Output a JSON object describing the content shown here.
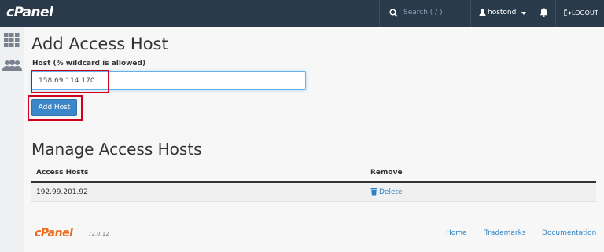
{
  "header": {
    "logo": "cPanel",
    "search_placeholder": "Search ( / )",
    "username": "hostond",
    "logout_label": "LOGOUT"
  },
  "sidebar": {
    "items": [
      {
        "icon": "grid-icon"
      },
      {
        "icon": "users-icon"
      }
    ]
  },
  "form": {
    "title": "Add Access Host",
    "field_label": "Host (% wildcard is allowed)",
    "host_value": "158.69.114.170",
    "submit_label": "Add Host"
  },
  "manage": {
    "title": "Manage Access Hosts",
    "columns": [
      "Access Hosts",
      "Remove"
    ],
    "rows": [
      {
        "host": "192.99.201.92",
        "action": "Delete"
      }
    ]
  },
  "footer": {
    "logo": "cPanel",
    "version": "72.0.12",
    "links": [
      "Home",
      "Trademarks",
      "Documentation"
    ]
  },
  "colors": {
    "navbar": "#293a4a",
    "accent": "#3b87c9",
    "highlight": "#d0021b",
    "brand_orange": "#f06a1b"
  }
}
